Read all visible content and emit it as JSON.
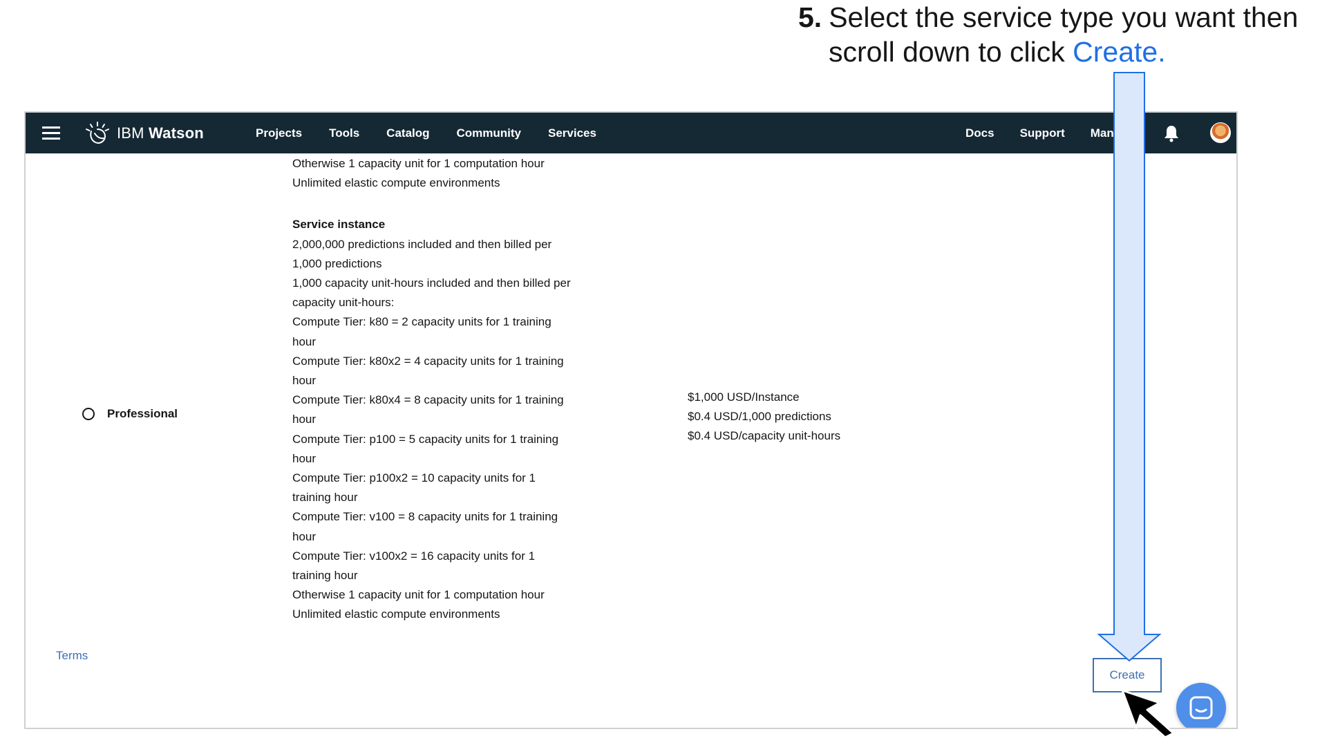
{
  "instruction": {
    "number": "5.",
    "line1": "Select the service type you want then",
    "line2_prefix": "scroll down to click ",
    "line2_link": "Create."
  },
  "topnav": {
    "brand_prefix": "IBM",
    "brand_name": "Watson",
    "left_items": [
      "Projects",
      "Tools",
      "Catalog",
      "Community",
      "Services"
    ],
    "right_items": [
      "Docs",
      "Support",
      "Mana"
    ],
    "icons": {
      "menu": "hamburger-icon",
      "logo": "watson-logo-icon",
      "notifications": "bell-icon",
      "avatar": "user-avatar"
    }
  },
  "plan": {
    "name": "Professional",
    "selected": false,
    "features_top": [
      "Otherwise 1 capacity unit for 1 computation hour",
      "Unlimited elastic compute environments"
    ],
    "service_instance_heading": "Service instance",
    "features": [
      "2,000,000 predictions included and then billed per",
      "1,000 predictions",
      "1,000 capacity unit-hours included and then billed per",
      "capacity unit-hours:",
      "Compute Tier: k80 = 2 capacity units for 1 training",
      "hour",
      "Compute Tier: k80x2 = 4 capacity units for 1 training",
      "hour",
      "Compute Tier: k80x4 = 8 capacity units for 1 training",
      "hour",
      "Compute Tier: p100 = 5 capacity units for 1 training",
      "hour",
      "Compute Tier: p100x2 = 10 capacity units for 1",
      "training hour",
      "Compute Tier: v100 = 8 capacity units for 1 training",
      "hour",
      "Compute Tier: v100x2 = 16 capacity units for 1",
      "training hour",
      "Otherwise 1 capacity unit for 1 computation hour",
      "Unlimited elastic compute environments"
    ],
    "pricing": [
      "$1,000 USD/Instance",
      "$0.4 USD/1,000 predictions",
      "$0.4 USD/capacity unit-hours"
    ]
  },
  "footer": {
    "terms_label": "Terms",
    "create_label": "Create"
  },
  "colors": {
    "nav_bg": "#152935",
    "link": "#3d70b2",
    "callout_link": "#1f6fe5",
    "chat_bubble": "#4f8ee9",
    "arrow_fill": "#dbe8fb",
    "arrow_stroke": "#1f6fe5"
  }
}
